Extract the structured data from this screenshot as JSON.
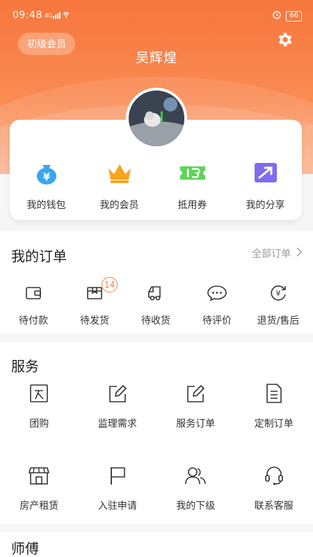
{
  "status_bar": {
    "time": "09:48",
    "signal": "4G",
    "battery": "66"
  },
  "profile": {
    "member_level": "初级会员",
    "username": "吴辉煌"
  },
  "quick_links": [
    {
      "label": "我的钱包",
      "icon": "wallet-money-bag-icon"
    },
    {
      "label": "我的会员",
      "icon": "crown-icon"
    },
    {
      "label": "抵用券",
      "icon": "coupon-ticket-icon"
    },
    {
      "label": "我的分享",
      "icon": "share-arrow-icon"
    }
  ],
  "orders": {
    "title": "我的订单",
    "all_orders_label": "全部订单",
    "items": [
      {
        "label": "待付款",
        "icon": "wallet-icon"
      },
      {
        "label": "待发货",
        "icon": "package-box-icon",
        "badge": "14"
      },
      {
        "label": "待收货",
        "icon": "delivery-truck-icon"
      },
      {
        "label": "待评价",
        "icon": "chat-bubble-icon"
      },
      {
        "label": "退货/售后",
        "icon": "yuan-refund-icon"
      }
    ]
  },
  "services": {
    "title": "服务",
    "items": [
      {
        "label": "团购",
        "icon": "group-buy-icon"
      },
      {
        "label": "监理需求",
        "icon": "edit-pencil-icon"
      },
      {
        "label": "服务订单",
        "icon": "edit-document-icon"
      },
      {
        "label": "定制订单",
        "icon": "document-list-icon"
      },
      {
        "label": "房产租赁",
        "icon": "storefront-icon"
      },
      {
        "label": "入驻申请",
        "icon": "flag-icon"
      },
      {
        "label": "我的下级",
        "icon": "users-icon"
      },
      {
        "label": "联系客服",
        "icon": "headset-icon"
      }
    ]
  },
  "masters": {
    "title": "师傅"
  },
  "colors": {
    "accent": "#f7773d",
    "badge": "#f5803e",
    "wallet_blue": "#3ba4ee",
    "crown_orange": "#f7a51e",
    "coupon_green": "#5fd35a",
    "share_purple": "#7d6cf0"
  }
}
